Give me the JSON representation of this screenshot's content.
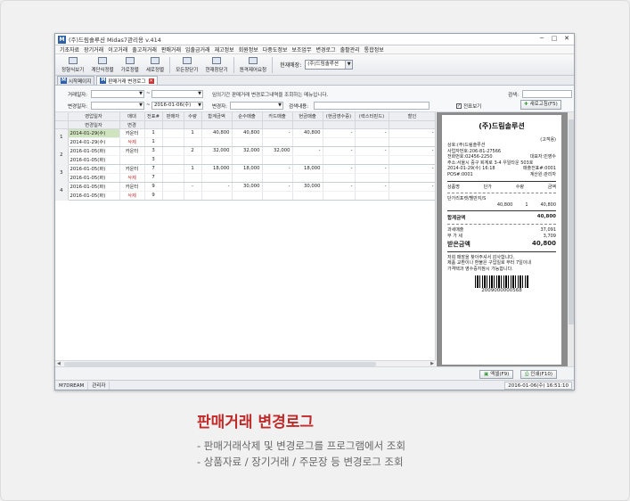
{
  "window": {
    "app_icon": "M",
    "title": "(주)드림솔루션 Midas7관리용 v.414",
    "minimize": "─",
    "maximize": "□",
    "close": "✕"
  },
  "menu": [
    "기초자료",
    "장기거래",
    "이고거래",
    "출고처거래",
    "판매거래",
    "입출금거래",
    "재고정보",
    "회원정보",
    "다중도정보",
    "보조업무",
    "변경로그",
    "출활관리",
    "통합정보"
  ],
  "toolbar": {
    "buttons": [
      "정형식보기",
      "계단식정렬",
      "가로정렬",
      "세로정렬",
      "모든창닫기",
      "현재창닫기",
      "원격제어요청"
    ],
    "store_label": "현재매장:",
    "store_value": "(주)드림솔루션"
  },
  "tabs": [
    {
      "label": "시작페이지",
      "active": false
    },
    {
      "label": "판매거래 변경로그",
      "active": true
    }
  ],
  "filter": {
    "trade_date_label": "거래일자:",
    "change_date_label": "변경일자:",
    "change_date_to": "2016-01-06(수)",
    "changer_label": "변경자:",
    "search_content_label": "검색내용:",
    "note": "임의기간 판매거래 변경로그내역을 조회하는 메뉴입니다.",
    "search_label": "검색:",
    "receipt_view_label": "전표보기",
    "refresh_button": "새로고침(F5)",
    "tilde": "~",
    "dd_icon": "▼",
    "check_mark": "✓"
  },
  "grid": {
    "headers": [
      "",
      "영업일자",
      "매대",
      "전표#",
      "판매자",
      "수량",
      "합계금액",
      "순수매출",
      "카드매출",
      "현금매출",
      "(현금영수증)",
      "(력스터핀드)",
      "할인"
    ],
    "header_row2": [
      "",
      "변경일자",
      "변경"
    ],
    "rows": [
      {
        "no": "1",
        "d1": "2014-01-29(수)",
        "d2": "2014-01-29(수)",
        "s1": "카운터",
        "s2": "삭제",
        "v1": "1",
        "v2": "1",
        "seller": "",
        "qty": "1",
        "total": "40,800",
        "net": "40,800",
        "card": "-",
        "cash": "40,800",
        "cashr": "-",
        "etc": "-",
        "disc": "-"
      },
      {
        "no": "2",
        "d1": "2016-01-05(화)",
        "d2": "2016-01-05(화)",
        "s1": "카운터",
        "s2": "",
        "v1": "3",
        "v2": "3",
        "seller": "",
        "qty": "2",
        "total": "32,000",
        "net": "32,000",
        "card": "32,000",
        "cash": "-",
        "cashr": "-",
        "etc": "-",
        "disc": "-"
      },
      {
        "no": "3",
        "d1": "2016-01-05(화)",
        "d2": "2016-01-05(화)",
        "s1": "카운터",
        "s2": "삭제",
        "v1": "7",
        "v2": "7",
        "seller": "",
        "qty": "1",
        "total": "18,000",
        "net": "18,000",
        "card": "-",
        "cash": "18,000",
        "cashr": "-",
        "etc": "-",
        "disc": "-"
      },
      {
        "no": "4",
        "d1": "2016-01-05(화)",
        "d2": "2016-01-05(화)",
        "s1": "카운터",
        "s2": "삭제",
        "v1": "9",
        "v2": "9",
        "seller": "",
        "qty": "-",
        "total": "-",
        "net": "30,000",
        "card": "-",
        "cash": "30,000",
        "cashr": "-",
        "etc": "-",
        "disc": "-"
      }
    ],
    "scroll_left": "◀",
    "scroll_right": "▶"
  },
  "receipt": {
    "company": "(주)드림솔루션",
    "copy_type": "(고객용)",
    "lines": [
      "상호:(주)드림솔루션",
      "사업자번호:206-81-27566"
    ],
    "phone_row": [
      "전화번호:02456-2250",
      "대표자:민영수"
    ],
    "address": "주소:서울시 중구 퇴계로 3-4 우일타운 503호",
    "datetime_row": [
      "2014-01-29(수) 16:18",
      "매출전표#:0001"
    ],
    "pos_row": [
      "POS#:0001",
      "계산원:관리자"
    ],
    "item_header": [
      "상품명",
      "단가",
      "수량",
      "금액"
    ],
    "item_name": "단가리포켓/헬만지/S",
    "item_values": [
      "40,800",
      "1",
      "40,800"
    ],
    "sum_label": "합계금액",
    "sum_value": "40,800",
    "tax_label": "과세매출",
    "tax_value": "37,091",
    "vat_label": "부 가 세",
    "vat_value": "3,709",
    "pay_label": "받은금액",
    "pay_value": "40,800",
    "footer": [
      "저희 매장을 찾아주셔서 감사합니다.",
      "제품 교환이나 환불은 구입일로 부터 7일이내",
      "가격택과 영수증지참시 가능합니다."
    ],
    "barcode_number": "2009000000568"
  },
  "bottom": {
    "excel_button": "엑셀(F9)",
    "print_button": "인쇄(F10)"
  },
  "status": {
    "company": "M7DREAM",
    "user": "관리자",
    "datetime": "2016-01-06(수) 16:51:10"
  },
  "caption": {
    "title": "판매거래 변경로그",
    "line1": "- 판매거래삭제 및 변경로그를 프로그램에서 조회",
    "line2": "- 상품자료 / 장기거래 / 주문장 등 변경로그 조회"
  }
}
